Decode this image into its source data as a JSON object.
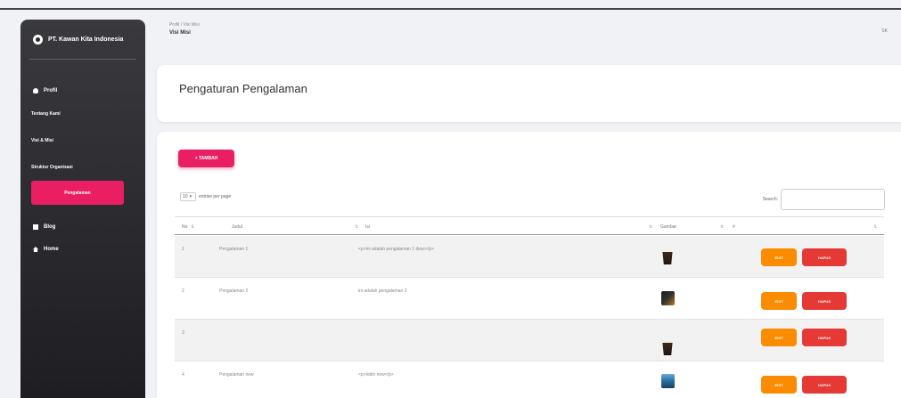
{
  "colors": {
    "accent": "#e91e63",
    "edit": "#fb8c00",
    "delete": "#e53935",
    "sidebar": "#2a2a2e"
  },
  "sidebar": {
    "brand": "PT. Kawan Kita Indonesia",
    "profil": "Profil",
    "items": [
      {
        "label": "Tentang Kami"
      },
      {
        "label": "Visi & Misi"
      },
      {
        "label": "Struktur Organisasi"
      },
      {
        "label": "Pengalaman"
      }
    ],
    "blog": "Blog",
    "home": "Home"
  },
  "breadcrumb": {
    "path": "Profil / Visi Misi",
    "title": "Visi Misi",
    "right": "SK"
  },
  "header": {
    "title": "Pengaturan Pengalaman"
  },
  "main": {
    "add_label": "+ TAMBAH",
    "entries_value": "10",
    "entries_suffix": "entries per page",
    "search_label": "Search:",
    "columns": [
      "No",
      "Judul",
      "Isi",
      "Gambar",
      "#"
    ],
    "rows": [
      {
        "no": "1",
        "judul": "Pengalaman 1",
        "isi": "<p>ini adalah pengalaman 1 desc</p>",
        "gambar": "cup"
      },
      {
        "no": "2",
        "judul": "Pengalaman 2",
        "isi": "ini adalah pengalaman 2",
        "gambar": "dark"
      },
      {
        "no": "3",
        "judul": "",
        "isi": "",
        "gambar": "cup"
      },
      {
        "no": "4",
        "judul": "Pengalaman new",
        "isi": "<p>lobin new</p>",
        "gambar": "blue"
      }
    ],
    "edit_label": "EDIT",
    "delete_label": "HAPUS"
  }
}
